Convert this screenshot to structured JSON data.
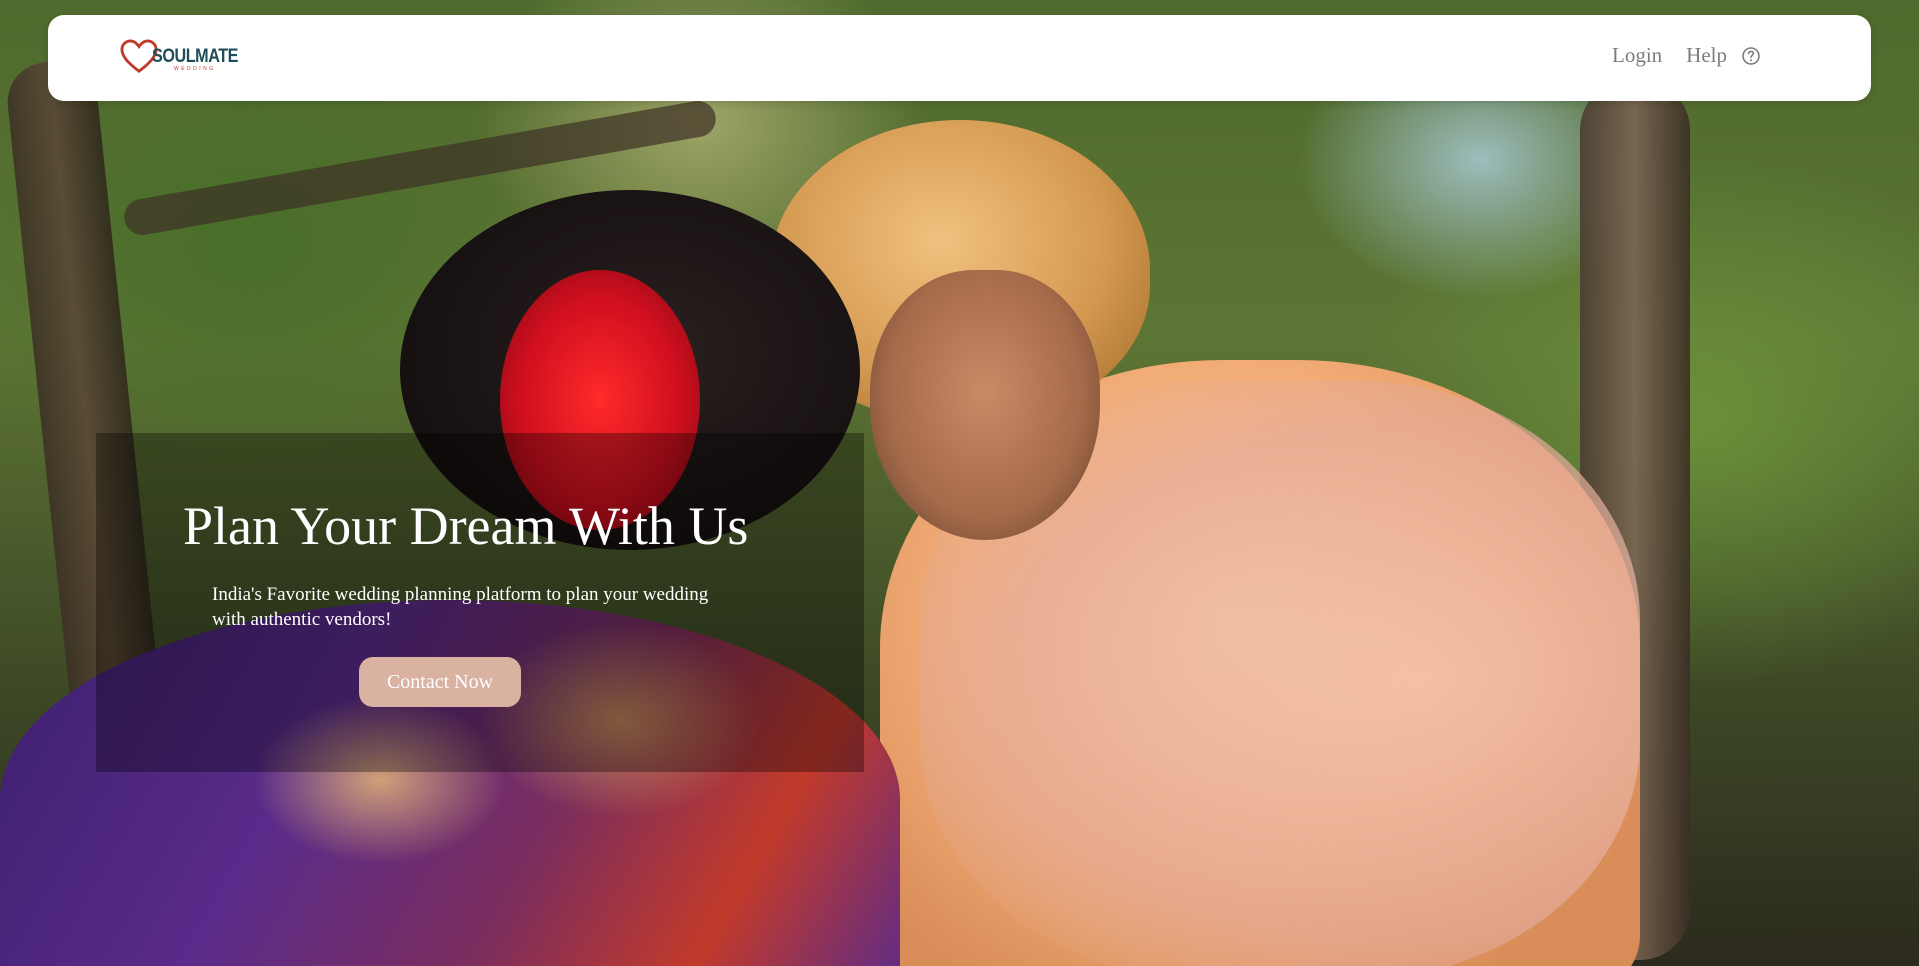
{
  "navbar": {
    "logo": {
      "name": "SOULMATE",
      "tagline": "WEDDING",
      "icon": "heart-icon"
    },
    "links": {
      "login": "Login",
      "help": "Help"
    },
    "help_icon": "question-circle-icon"
  },
  "hero": {
    "title": "Plan Your Dream With Us",
    "subtitle": "India's Favorite wedding planning platform to plan your wedding with authentic vendors!",
    "cta_label": "Contact Now"
  },
  "colors": {
    "logo_text": "#1d4e57",
    "logo_heart": "#c0392b",
    "nav_link": "#7d7d7d",
    "cta_background": "#d9b2a2",
    "hero_text": "#ffffff"
  }
}
